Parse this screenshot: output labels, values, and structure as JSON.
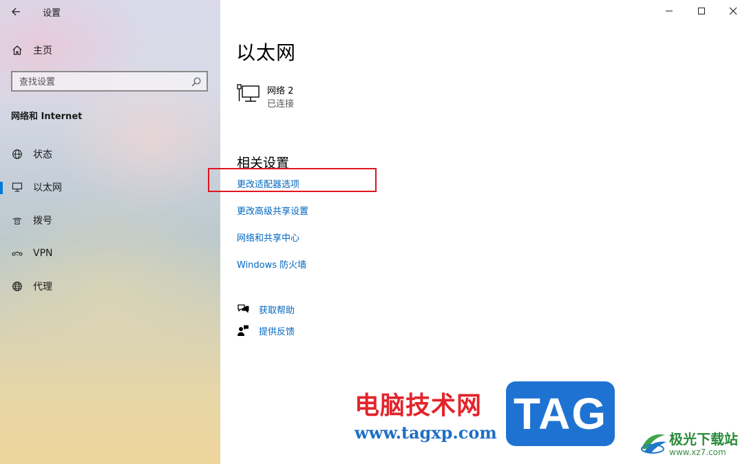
{
  "window": {
    "title": "设置",
    "controls": [
      "minimize",
      "maximize",
      "close"
    ]
  },
  "sidebar": {
    "home_label": "主页",
    "search": {
      "placeholder": "查找设置"
    },
    "section_title": "网络和 Internet",
    "items": [
      {
        "label": "状态",
        "icon": "globe-status-icon",
        "active": false
      },
      {
        "label": "以太网",
        "icon": "ethernet-icon",
        "active": true
      },
      {
        "label": "拨号",
        "icon": "dialup-icon",
        "active": false
      },
      {
        "label": "VPN",
        "icon": "vpn-icon",
        "active": false
      },
      {
        "label": "代理",
        "icon": "globe-icon",
        "active": false
      }
    ]
  },
  "main": {
    "title": "以太网",
    "network": {
      "name": "网络 2",
      "status": "已连接"
    },
    "related_title": "相关设置",
    "links": [
      "更改适配器选项",
      "更改高级共享设置",
      "网络和共享中心",
      "Windows 防火墙"
    ],
    "help": {
      "get_help": "获取帮助",
      "feedback": "提供反馈"
    }
  },
  "watermark": {
    "site_name": "电脑技术网",
    "site_url": "www.tagxp.com",
    "badge": "TAG",
    "site2_name": "极光下载站",
    "site2_url": "www.xz7.com"
  },
  "colors": {
    "accent": "#0078d4",
    "link": "#0067c0",
    "highlight_box": "#e0141e"
  }
}
